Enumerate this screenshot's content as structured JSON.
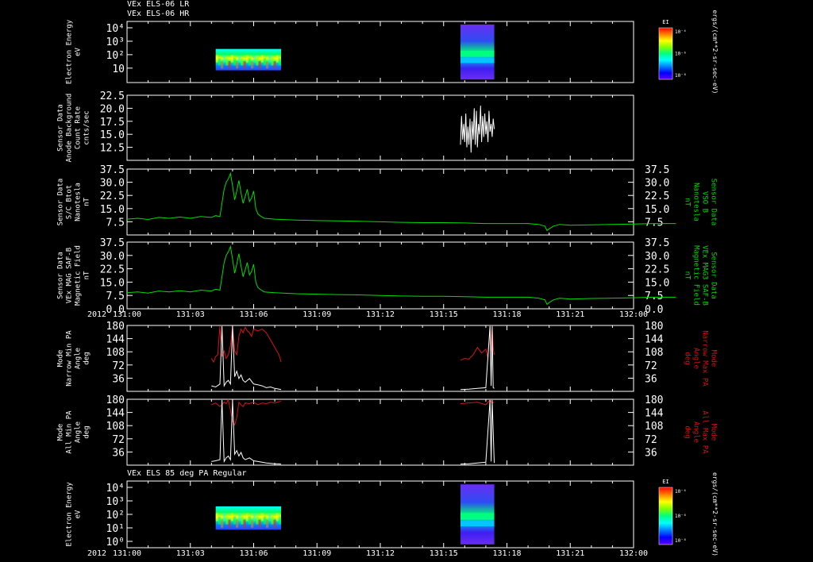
{
  "header": {
    "title_line1": "VEx ELS-06 LR",
    "title_line2": "VEx ELS-06 HR",
    "panel7_title": "VEx ELS 85 deg PA Regular"
  },
  "colors": {
    "background": "#000000",
    "axes": "#ffffff",
    "trace_white": "#ffffff",
    "trace_green": "#00dd00",
    "trace_red": "#dd1111",
    "colorbar": [
      "#ff0000",
      "#ff8000",
      "#ffff00",
      "#80ff00",
      "#00ff80",
      "#00ffff",
      "#0080ff",
      "#0000ff",
      "#6000ff"
    ]
  },
  "chart_data": [
    {
      "id": "panel1",
      "type": "heatmap",
      "ylabel": [
        "Electron Energy",
        "eV"
      ],
      "y_scale": "log",
      "y_ticks": [
        "10⁴",
        "10³",
        "10²",
        "10"
      ],
      "colorbar": {
        "label": "EI",
        "ticks": [
          "10⁻⁴",
          "10⁻⁶",
          "10⁻⁸"
        ]
      },
      "right_label": "ergs/(cm**2-sr-sec-eV)",
      "data_intervals": [
        [
          "131:04.2",
          "131:07.3"
        ],
        [
          "131:15.8",
          "131:17.4"
        ]
      ]
    },
    {
      "id": "panel2",
      "type": "line",
      "ylabel": [
        "Sensor Data",
        "Anode Background",
        "Count Rate",
        "cnts/sec"
      ],
      "ylim": [
        10,
        22.5
      ],
      "y_ticks": [
        "22.5",
        "20.0",
        "17.5",
        "15.0",
        "12.5"
      ],
      "series": [
        {
          "color": "white",
          "x": [
            15.8,
            15.85,
            15.9,
            15.95,
            16.0,
            16.05,
            16.1,
            16.15,
            16.2,
            16.25,
            16.3,
            16.35,
            16.4,
            16.45,
            16.5,
            16.55,
            16.6,
            16.65,
            16.7,
            16.75,
            16.8,
            16.85,
            16.9,
            16.95,
            17.0,
            17.05,
            17.1,
            17.15,
            17.2,
            17.25,
            17.3,
            17.35,
            17.4
          ],
          "values": [
            13.0,
            18.5,
            14.0,
            17.0,
            13.5,
            19.0,
            12.5,
            16.5,
            13.0,
            18.0,
            11.5,
            17.5,
            14.0,
            20.0,
            13.0,
            19.5,
            12.5,
            17.0,
            15.0,
            20.5,
            13.5,
            18.5,
            14.5,
            19.0,
            15.0,
            17.5,
            13.5,
            19.5,
            15.5,
            17.0,
            14.5,
            18.0,
            16.0
          ]
        }
      ]
    },
    {
      "id": "panel3",
      "type": "line",
      "ylabel": [
        "Sensor Data",
        "S/C Btot",
        "Nanotesla",
        "nT"
      ],
      "right_label": [
        "Sensor Data",
        "VSO B",
        "Nanotesla",
        "nT"
      ],
      "ylim": [
        0,
        37.5
      ],
      "y_ticks": [
        "37.5",
        "30.0",
        "22.5",
        "15.0",
        "7.5"
      ],
      "series": [
        {
          "color": "green",
          "x": [
            0,
            0.5,
            1,
            1.5,
            2,
            2.5,
            3,
            3.5,
            4,
            4.2,
            4.4,
            4.6,
            4.7,
            4.8,
            4.9,
            5.0,
            5.1,
            5.2,
            5.3,
            5.4,
            5.5,
            5.6,
            5.7,
            5.8,
            5.9,
            6.0,
            6.1,
            6.2,
            6.3,
            6.5,
            7,
            8,
            9,
            10,
            11,
            12,
            13,
            14,
            15,
            16,
            17,
            18,
            19,
            19.5,
            19.8,
            19.9,
            20.0,
            20.2,
            20.5,
            21,
            22,
            23,
            24,
            25,
            26
          ],
          "values": [
            9,
            9.5,
            8.8,
            10,
            9.5,
            10.2,
            9.5,
            10.5,
            10,
            11,
            10.5,
            26,
            30,
            32,
            35,
            28,
            20,
            25,
            31,
            24,
            18,
            22,
            26,
            19,
            21,
            25,
            15,
            12,
            11,
            9.5,
            9,
            8.5,
            8.2,
            8,
            7.8,
            7.5,
            7.2,
            7,
            7,
            6.8,
            6.5,
            6.5,
            6.5,
            6,
            5,
            2.5,
            3.5,
            5,
            6,
            5.5,
            5.8,
            6,
            6.2,
            6.5,
            6.5
          ]
        }
      ]
    },
    {
      "id": "panel4",
      "type": "line",
      "ylabel": [
        "Sensor Data",
        "VEx MAG SAF-B",
        "Magnetic Field",
        "nT"
      ],
      "right_label": [
        "Sensor Data",
        "VEx MAG3 SAF-B",
        "Magnetic Field",
        "nT"
      ],
      "ylim": [
        0,
        37.5
      ],
      "y_ticks": [
        "37.5",
        "30.0",
        "22.5",
        "15.0",
        "7.5",
        "0.0"
      ],
      "series": [
        {
          "color": "green",
          "x": [
            0,
            0.5,
            1,
            1.5,
            2,
            2.5,
            3,
            3.5,
            4,
            4.2,
            4.4,
            4.6,
            4.7,
            4.8,
            4.9,
            5.0,
            5.1,
            5.2,
            5.3,
            5.4,
            5.5,
            5.6,
            5.7,
            5.8,
            5.9,
            6.0,
            6.1,
            6.2,
            6.3,
            6.5,
            7,
            8,
            9,
            10,
            11,
            12,
            13,
            14,
            15,
            16,
            17,
            18,
            19,
            19.5,
            19.8,
            19.9,
            20.0,
            20.2,
            20.5,
            21,
            22,
            23,
            24,
            25,
            26
          ],
          "values": [
            9,
            9.5,
            8.8,
            10,
            9.5,
            10.2,
            9.5,
            10.5,
            10,
            11,
            10.5,
            26,
            30,
            32,
            35,
            28,
            20,
            25,
            31,
            24,
            18,
            22,
            26,
            19,
            21,
            25,
            15,
            12,
            11,
            9.5,
            9,
            8.5,
            8.2,
            8,
            7.8,
            7.5,
            7.2,
            7,
            7,
            6.8,
            6.5,
            6.5,
            6.5,
            6,
            5,
            2.5,
            3.5,
            5,
            6,
            5.5,
            5.8,
            6,
            6.2,
            6.5,
            6.5
          ]
        }
      ]
    },
    {
      "id": "panel5",
      "type": "line",
      "ylabel": [
        "Mode",
        "Narrow Min PA",
        "Angle",
        "deg"
      ],
      "right_label": [
        "Mode",
        "Narrow Max PA",
        "Angle",
        "deg"
      ],
      "ylim": [
        0,
        180
      ],
      "y_ticks": [
        "180",
        "144",
        "108",
        "72",
        "36"
      ],
      "series": [
        {
          "color": "red",
          "segments": [
            {
              "x": [
                4.0,
                4.1,
                4.2,
                4.3,
                4.4,
                4.5,
                4.6,
                4.7,
                4.8,
                4.9,
                5.0,
                5.1,
                5.2,
                5.3,
                5.4,
                5.5,
                5.6,
                5.7,
                5.8,
                5.9,
                6.0,
                6.2,
                6.4,
                6.6,
                6.8,
                7.0,
                7.2,
                7.3
              ],
              "values": [
                90,
                80,
                95,
                100,
                178,
                95,
                110,
                90,
                100,
                125,
                178,
                110,
                100,
                150,
                170,
                160,
                175,
                165,
                160,
                150,
                170,
                165,
                170,
                160,
                140,
                120,
                100,
                80
              ]
            },
            {
              "x": [
                15.8,
                16.0,
                16.2,
                16.4,
                16.6,
                16.8,
                17.0,
                17.1,
                17.2,
                17.25,
                17.3,
                17.35,
                17.4
              ],
              "values": [
                85,
                90,
                88,
                100,
                120,
                105,
                115,
                90,
                178,
                110,
                175,
                120,
                100
              ]
            }
          ]
        },
        {
          "color": "white",
          "segments": [
            {
              "x": [
                4.0,
                4.2,
                4.4,
                4.5,
                4.6,
                4.7,
                4.8,
                4.9,
                5.0,
                5.1,
                5.2,
                5.3,
                5.4,
                5.5,
                5.6,
                5.8,
                6.0,
                6.2,
                6.4,
                6.6,
                6.8,
                7.0,
                7.3
              ],
              "values": [
                15,
                12,
                20,
                178,
                15,
                25,
                30,
                20,
                178,
                40,
                55,
                35,
                45,
                30,
                25,
                35,
                20,
                18,
                15,
                10,
                12,
                8,
                5
              ]
            },
            {
              "x": [
                15.8,
                16.2,
                16.6,
                17.0,
                17.2,
                17.25,
                17.3,
                17.35,
                17.4
              ],
              "values": [
                5,
                6,
                8,
                10,
                178,
                15,
                178,
                10,
                8
              ]
            }
          ]
        }
      ]
    },
    {
      "id": "panel6",
      "type": "line",
      "ylabel": [
        "Mode",
        "All Min PA",
        "Angle",
        "deg"
      ],
      "right_label": [
        "Mode",
        "All Max PA",
        "Angle",
        "deg"
      ],
      "ylim": [
        0,
        180
      ],
      "y_ticks": [
        "180",
        "144",
        "108",
        "72",
        "36"
      ],
      "series": [
        {
          "color": "red",
          "segments": [
            {
              "x": [
                4.0,
                4.2,
                4.4,
                4.6,
                4.7,
                4.8,
                4.9,
                5.0,
                5.1,
                5.2,
                5.3,
                5.4,
                5.5,
                5.6,
                5.8,
                6.0,
                6.2,
                6.4,
                6.6,
                6.8,
                7.0,
                7.3
              ],
              "values": [
                165,
                170,
                160,
                172,
                168,
                178,
                150,
                120,
                110,
                130,
                172,
                165,
                160,
                170,
                168,
                172,
                165,
                170,
                168,
                172,
                170,
                175
              ]
            },
            {
              "x": [
                15.8,
                16.2,
                16.6,
                17.0,
                17.2,
                17.3,
                17.4
              ],
              "values": [
                168,
                170,
                172,
                165,
                178,
                170,
                172
              ]
            }
          ]
        },
        {
          "color": "white",
          "segments": [
            {
              "x": [
                4.0,
                4.2,
                4.4,
                4.5,
                4.6,
                4.7,
                4.8,
                4.9,
                5.0,
                5.1,
                5.2,
                5.3,
                5.4,
                5.5,
                5.6,
                5.8,
                6.0,
                6.2,
                6.4,
                6.6,
                6.8,
                7.0,
                7.3
              ],
              "values": [
                10,
                12,
                15,
                178,
                10,
                20,
                25,
                15,
                178,
                30,
                40,
                25,
                35,
                20,
                15,
                20,
                12,
                10,
                8,
                6,
                5,
                4,
                3
              ]
            },
            {
              "x": [
                15.8,
                16.2,
                16.6,
                17.0,
                17.2,
                17.25,
                17.3,
                17.4
              ],
              "values": [
                3,
                4,
                6,
                8,
                178,
                10,
                178,
                6
              ]
            }
          ]
        }
      ]
    },
    {
      "id": "panel7",
      "type": "heatmap",
      "ylabel": [
        "Electron Energy",
        "eV"
      ],
      "y_scale": "log",
      "y_ticks": [
        "10⁴",
        "10³",
        "10²",
        "10¹",
        "10⁰"
      ],
      "colorbar": {
        "label": "EI",
        "ticks": [
          "10⁻⁴",
          "10⁻⁶",
          "10⁻⁸"
        ]
      },
      "right_label": "ergs/(cm**2-sr-sec-eV)",
      "data_intervals": [
        [
          "131:04.2",
          "131:07.3"
        ],
        [
          "131:15.8",
          "131:17.4"
        ]
      ]
    }
  ],
  "x_axis": {
    "year_label": "2012",
    "tick_labels": [
      "131:00",
      "131:03",
      "131:06",
      "131:09",
      "131:12",
      "131:15",
      "131:18",
      "131:21",
      "132:00"
    ],
    "range_hours": [
      0,
      24
    ]
  }
}
